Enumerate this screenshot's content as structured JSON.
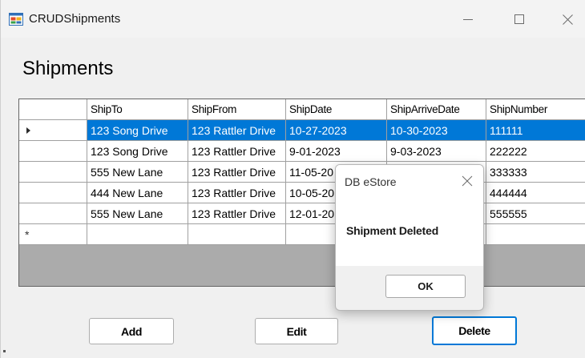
{
  "window": {
    "title": "CRUDShipments",
    "icon": "winforms-app-icon",
    "controls": [
      "minimize-icon",
      "maximize-icon",
      "close-icon"
    ]
  },
  "heading": "Shipments",
  "grid": {
    "columns": [
      "ShipTo",
      "ShipFrom",
      "ShipDate",
      "ShipArriveDate",
      "ShipNumber"
    ],
    "rows": [
      [
        "123 Song Drive",
        "123 Rattler Drive",
        "10-27-2023",
        "10-30-2023",
        "111111"
      ],
      [
        "123 Song Drive",
        "123 Rattler Drive",
        "9-01-2023",
        "9-03-2023",
        "222222"
      ],
      [
        "555 New Lane",
        "123 Rattler Drive",
        "11-05-20",
        "",
        "333333"
      ],
      [
        "444 New Lane",
        "123 Rattler Drive",
        "10-05-20",
        "",
        "444444"
      ],
      [
        "555 New Lane",
        "123 Rattler Drive",
        "12-01-20",
        "",
        "555555"
      ]
    ],
    "selected_row": 0,
    "new_row_marker": "*",
    "selection_color": "#0078d7"
  },
  "buttons": {
    "add": "Add",
    "edit": "Edit",
    "delete": "Delete"
  },
  "dialog": {
    "title": "DB eStore",
    "message": "Shipment Deleted",
    "ok": "OK"
  }
}
